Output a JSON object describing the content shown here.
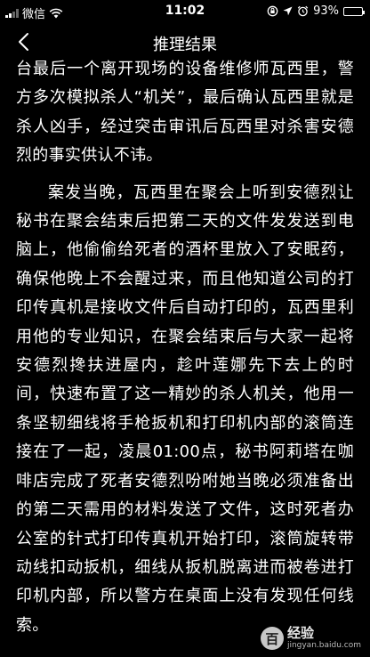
{
  "status_bar": {
    "carrier": "微信",
    "time": "11:02",
    "battery_percent": "93%",
    "battery_level": 0.93
  },
  "nav": {
    "title": "推理结果"
  },
  "article": {
    "paragraph_1": "台最后一个离开现场的设备维修师瓦西里，警方多次模拟杀人“机关”，最后确认瓦西里就是杀人凶手，经过突击审讯后瓦西里对杀害安德烈的事实供认不讳。",
    "paragraph_2": "案发当晚，瓦西里在聚会上听到安德烈让秘书在聚会结束后把第二天的文件发发送到电脑上，他偷偷给死者的酒杯里放入了安眠药，确保他晚上不会醒过来，而且他知道公司的打印传真机是接收文件后自动打印的，瓦西里利用他的专业知识，在聚会结束后与大家一起将安德烈搀扶进屋内，趁叶莲娜先下去上的时间，快速布置了这一精妙的杀人机关，他用一条坚韧细线将手枪扳机和打印机内部的滚筒连接在了一起，凌晨01:00点，秘书阿莉塔在咖啡店完成了死者安德烈吩咐她当晚必须准备出的第二天需用的材料发送了文件，这时死者办公室的针式打印传真机开始打印，滚筒旋转带动线扣动扳机，细线从扳机脱离进而被卷进打印机内部，所以警方在桌面上没有发现任何线索。"
  },
  "watermark": {
    "logo": "百",
    "name": "经验",
    "url": "jingyan.baidu.com"
  }
}
